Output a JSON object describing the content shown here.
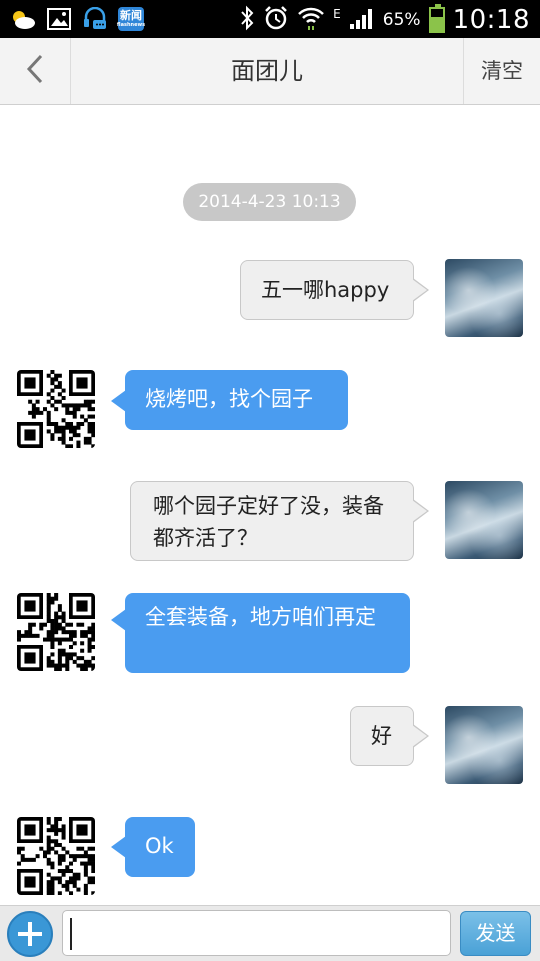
{
  "status_bar": {
    "battery_text": "65%",
    "battery_level": 0.65,
    "network_type": "E",
    "time": "10:18",
    "news_icon_label": "新闻",
    "news_icon_sub": "flashnews",
    "icons": [
      "weather-icon",
      "gallery-icon",
      "headset-chat-icon",
      "news-app-icon",
      "bluetooth-icon",
      "alarm-icon",
      "wifi-icon",
      "signal-icon",
      "battery-icon"
    ]
  },
  "titlebar": {
    "back_icon": "chevron-left-icon",
    "title": "面团儿",
    "clear_label": "清空"
  },
  "chat": {
    "timestamp": "2014-4-23 10:13",
    "messages": [
      {
        "side": "right",
        "text": "五一哪happy"
      },
      {
        "side": "left",
        "text": "烧烤吧，找个园子"
      },
      {
        "side": "right",
        "text": "哪个园子定好了没，装备都齐活了？"
      },
      {
        "side": "left",
        "text": "全套装备，地方咱们再定"
      },
      {
        "side": "right",
        "text": "好"
      },
      {
        "side": "left",
        "text": "Ok"
      }
    ]
  },
  "input_bar": {
    "plus_icon": "plus-icon",
    "input_value": "",
    "input_placeholder": "",
    "send_label": "发送"
  },
  "colors": {
    "outgoing_bubble": "#efefef",
    "incoming_bubble": "#4a9cf0",
    "send_button": "#4aa1d6",
    "timestamp_pill": "#c8c8c8"
  }
}
